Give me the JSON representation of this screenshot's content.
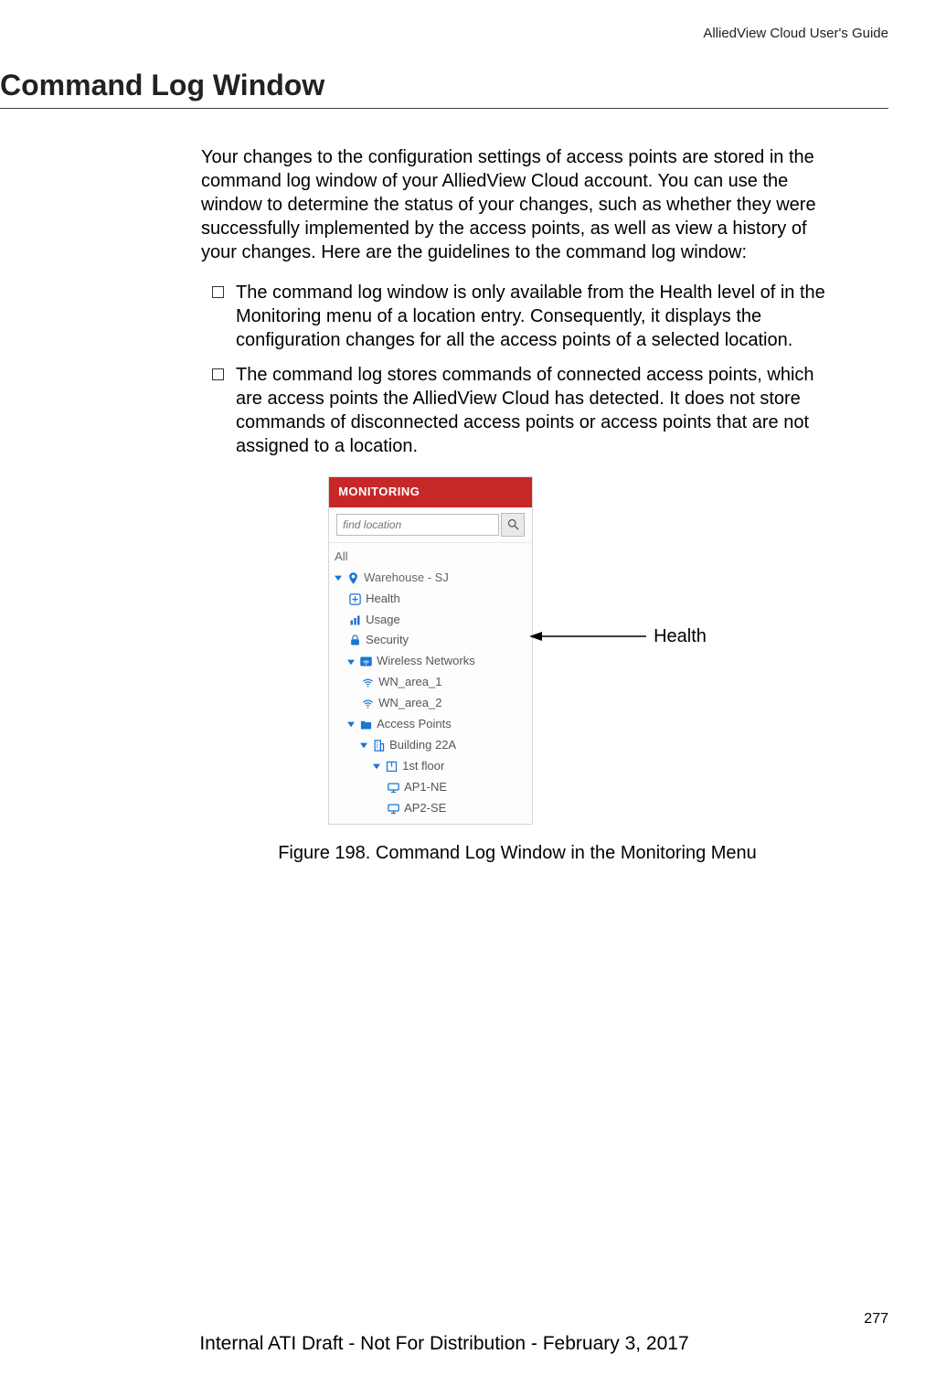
{
  "header": {
    "running_title": "AlliedView Cloud User's Guide"
  },
  "section": {
    "title": "Command Log Window"
  },
  "body": {
    "intro": "Your changes to the configuration settings of access points are stored in the command log window of your AlliedView Cloud account. You can use the window to determine the status of your changes, such as whether they were successfully implemented by the access points, as well as view a history of your changes. Here are the guidelines to the command log window:",
    "bullets": [
      "The command log window is only available from the Health level of in the Monitoring menu of a location entry. Consequently, it displays the configuration changes for all the access points of a selected location.",
      "The command log stores commands of connected access points, which are access points the AlliedView Cloud has detected. It does not store commands of disconnected access points or access points that are not assigned to a location."
    ]
  },
  "panel": {
    "title": "MONITORING",
    "search_placeholder": "find location",
    "all_label": "All",
    "location": "Warehouse - SJ",
    "items": {
      "health": "Health",
      "usage": "Usage",
      "security": "Security",
      "wireless_networks": "Wireless Networks",
      "wn1": "WN_area_1",
      "wn2": "WN_area_2",
      "access_points": "Access Points",
      "building": "Building 22A",
      "floor": "1st floor",
      "ap1": "AP1-NE",
      "ap2": "AP2-SE"
    }
  },
  "callout": {
    "label": "Health"
  },
  "figure": {
    "caption": "Figure 198. Command Log Window in the Monitoring Menu"
  },
  "footer": {
    "page_number": "277",
    "internal_note": "Internal ATI Draft - Not For Distribution - February 3, 2017"
  }
}
